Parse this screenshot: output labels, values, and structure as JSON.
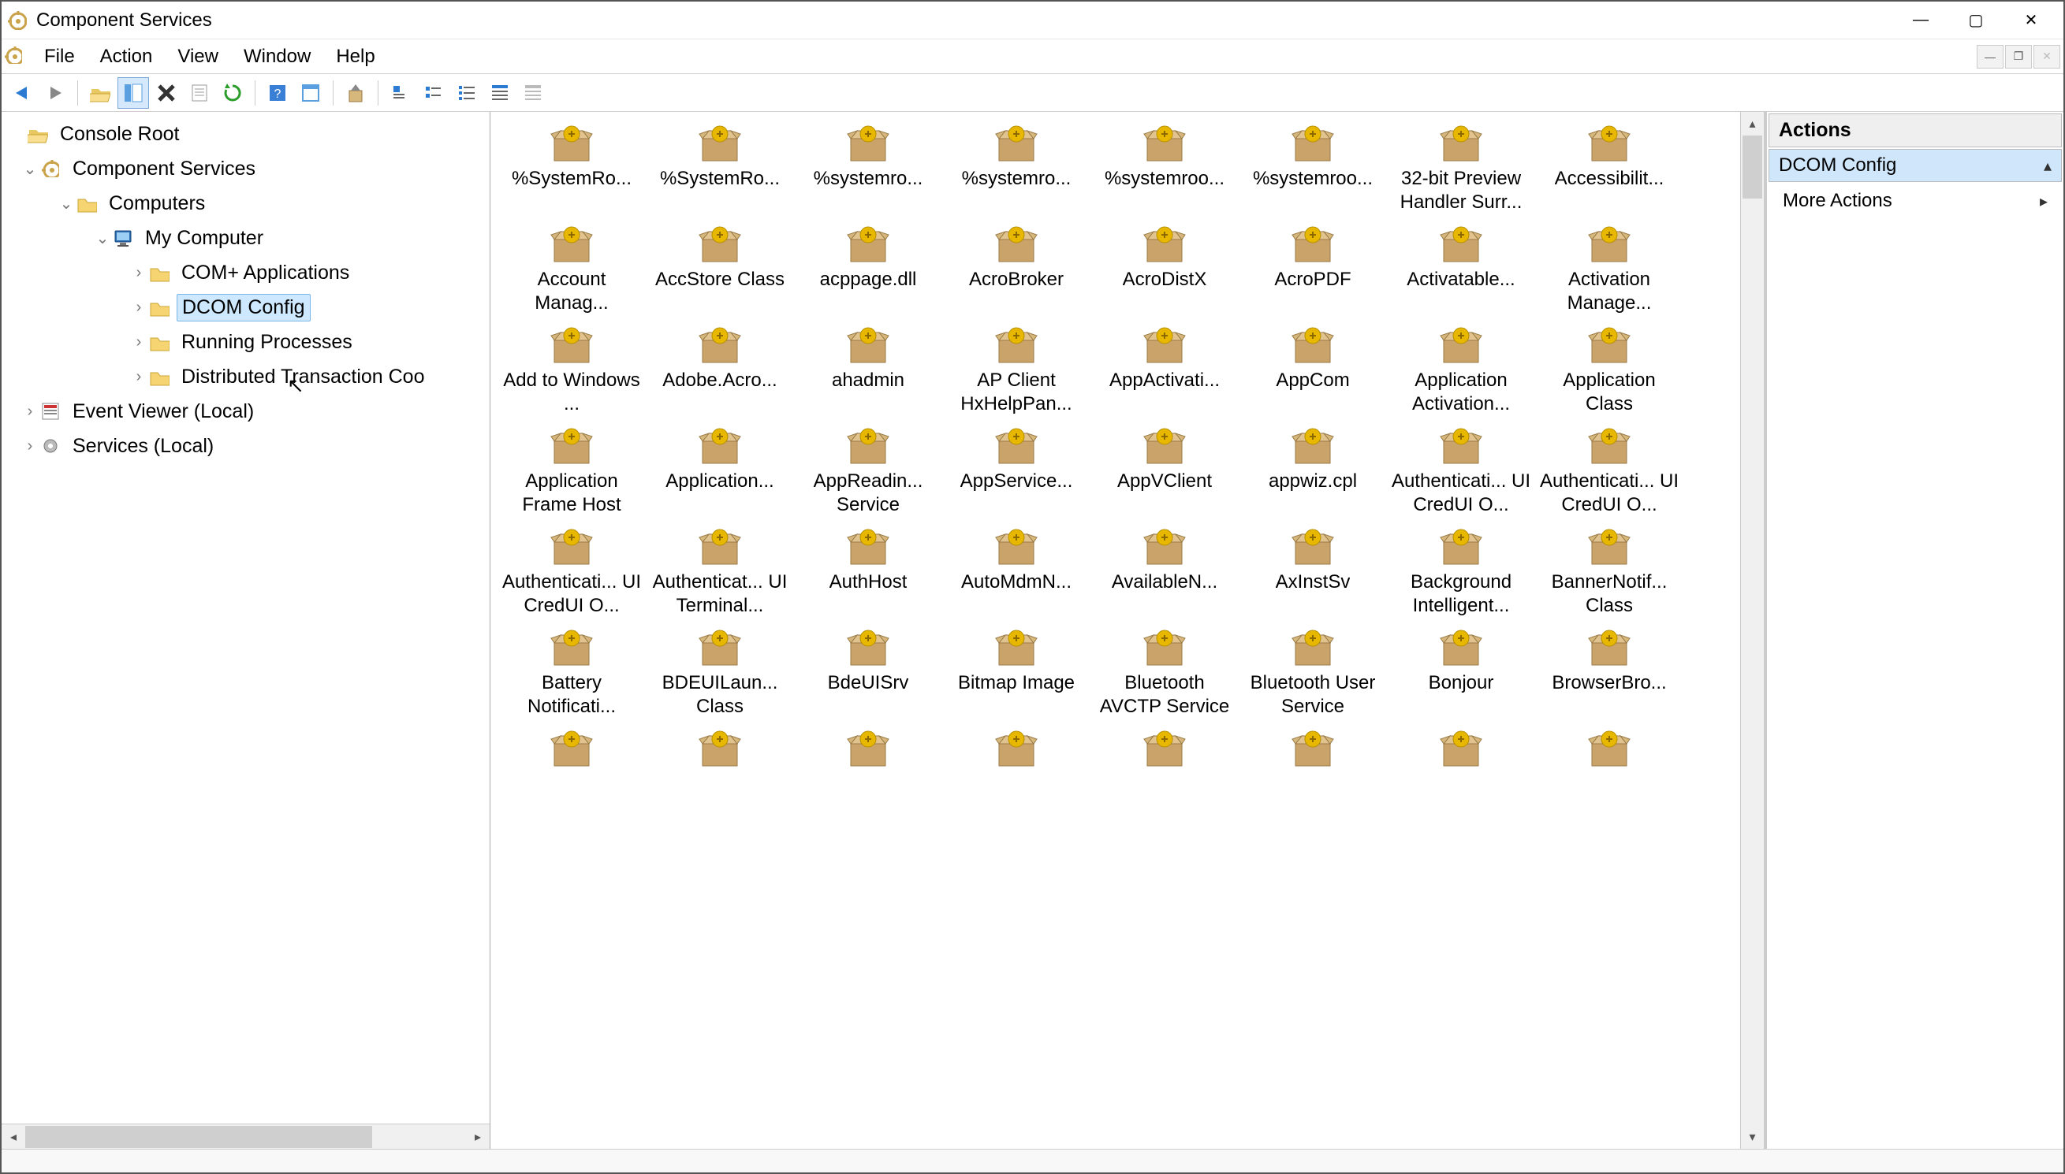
{
  "window": {
    "title": "Component Services"
  },
  "menu": {
    "items": [
      "File",
      "Action",
      "View",
      "Window",
      "Help"
    ]
  },
  "tree": {
    "root": {
      "label": "Console Root"
    },
    "nodes": {
      "component_services": "Component Services",
      "computers": "Computers",
      "my_computer": "My Computer",
      "com_plus": "COM+ Applications",
      "dcom_config": "DCOM Config",
      "running_processes": "Running Processes",
      "dtc": "Distributed Transaction Coo",
      "event_viewer": "Event Viewer (Local)",
      "services": "Services (Local)"
    },
    "selected": "dcom_config"
  },
  "actions": {
    "title": "Actions",
    "section": "DCOM Config",
    "more": "More Actions"
  },
  "grid_items": [
    {
      "label": "%SystemRo..."
    },
    {
      "label": "%SystemRo..."
    },
    {
      "label": "%systemro..."
    },
    {
      "label": "%systemro..."
    },
    {
      "label": "%systemroo..."
    },
    {
      "label": "%systemroo..."
    },
    {
      "label": "32-bit Preview Handler Surr..."
    },
    {
      "label": "Accessibilit..."
    },
    {
      "label": "Account Manag..."
    },
    {
      "label": "AccStore Class"
    },
    {
      "label": "acppage.dll"
    },
    {
      "label": "AcroBroker"
    },
    {
      "label": "AcroDistX"
    },
    {
      "label": "AcroPDF"
    },
    {
      "label": "Activatable..."
    },
    {
      "label": "Activation Manage..."
    },
    {
      "label": "Add to Windows ..."
    },
    {
      "label": "Adobe.Acro..."
    },
    {
      "label": "ahadmin"
    },
    {
      "label": "AP Client HxHelpPan..."
    },
    {
      "label": "AppActivati..."
    },
    {
      "label": "AppCom"
    },
    {
      "label": "Application Activation..."
    },
    {
      "label": "Application Class"
    },
    {
      "label": "Application Frame Host"
    },
    {
      "label": "Application..."
    },
    {
      "label": "AppReadin... Service"
    },
    {
      "label": "AppService..."
    },
    {
      "label": "AppVClient"
    },
    {
      "label": "appwiz.cpl"
    },
    {
      "label": "Authenticati... UI CredUI O..."
    },
    {
      "label": "Authenticati... UI CredUI O..."
    },
    {
      "label": "Authenticati... UI CredUI O..."
    },
    {
      "label": "Authenticat... UI Terminal..."
    },
    {
      "label": "AuthHost"
    },
    {
      "label": "AutoMdmN..."
    },
    {
      "label": "AvailableN..."
    },
    {
      "label": "AxInstSv"
    },
    {
      "label": "Background Intelligent..."
    },
    {
      "label": "BannerNotif... Class"
    },
    {
      "label": "Battery Notificati..."
    },
    {
      "label": "BDEUILaun... Class"
    },
    {
      "label": "BdeUISrv"
    },
    {
      "label": "Bitmap Image"
    },
    {
      "label": "Bluetooth AVCTP Service"
    },
    {
      "label": "Bluetooth User Service"
    },
    {
      "label": "Bonjour"
    },
    {
      "label": "BrowserBro..."
    },
    {
      "label": ""
    },
    {
      "label": ""
    },
    {
      "label": ""
    },
    {
      "label": ""
    },
    {
      "label": ""
    },
    {
      "label": ""
    },
    {
      "label": ""
    },
    {
      "label": ""
    }
  ]
}
